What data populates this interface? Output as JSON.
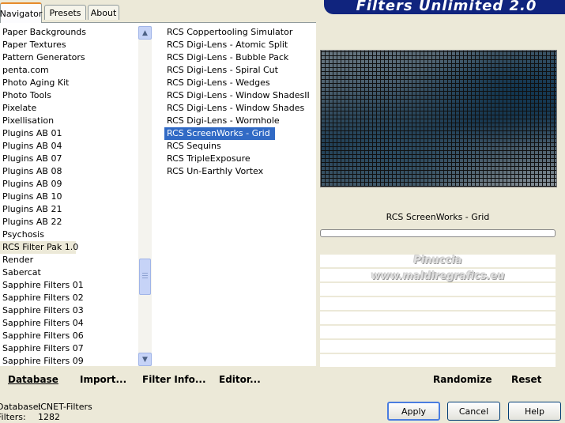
{
  "app_title": "Filters Unlimited 2.0",
  "tabs": [
    {
      "label": "Navigator",
      "active": true
    },
    {
      "label": "Presets",
      "active": false
    },
    {
      "label": "About",
      "active": false
    }
  ],
  "categories": [
    "Paper Backgrounds",
    "Paper Textures",
    "Pattern Generators",
    "penta.com",
    "Photo Aging Kit",
    "Photo Tools",
    "Pixelate",
    "Pixellisation",
    "Plugins AB 01",
    "Plugins AB 04",
    "Plugins AB 07",
    "Plugins AB 08",
    "Plugins AB 09",
    "Plugins AB 10",
    "Plugins AB 21",
    "Plugins AB 22",
    "Psychosis",
    "RCS Filter Pak 1.0",
    "Render",
    "Sabercat",
    "Sapphire Filters 01",
    "Sapphire Filters 02",
    "Sapphire Filters 03",
    "Sapphire Filters 04",
    "Sapphire Filters 06",
    "Sapphire Filters 07",
    "Sapphire Filters 09"
  ],
  "selected_category": "RCS Filter Pak 1.0",
  "filters": [
    "RCS Coppertooling Simulator",
    "RCS Digi-Lens - Atomic Split",
    "RCS Digi-Lens - Bubble Pack",
    "RCS Digi-Lens - Spiral Cut",
    "RCS Digi-Lens - Wedges",
    "RCS Digi-Lens - Window ShadesII",
    "RCS Digi-Lens - Window Shades",
    "RCS Digi-Lens - Wormhole",
    "RCS ScreenWorks - Grid",
    "RCS Sequins",
    "RCS TripleExposure",
    "RCS Un-Earthly Vortex"
  ],
  "selected_filter": "RCS ScreenWorks - Grid",
  "preview_filter_name": "RCS ScreenWorks - Grid",
  "watermark": {
    "line1": "Pinuccia",
    "line2": "www.maldiregrafics.eu"
  },
  "bottom": {
    "database": "Database",
    "import": "Import...",
    "filter_info": "Filter Info...",
    "editor": "Editor...",
    "randomize": "Randomize",
    "reset": "Reset"
  },
  "status": {
    "database_label": "Database:",
    "database_value": "ICNET-Filters",
    "filters_label": "Filters:",
    "filters_value": "1282"
  },
  "buttons": {
    "apply": "Apply",
    "cancel": "Cancel",
    "help": "Help"
  }
}
